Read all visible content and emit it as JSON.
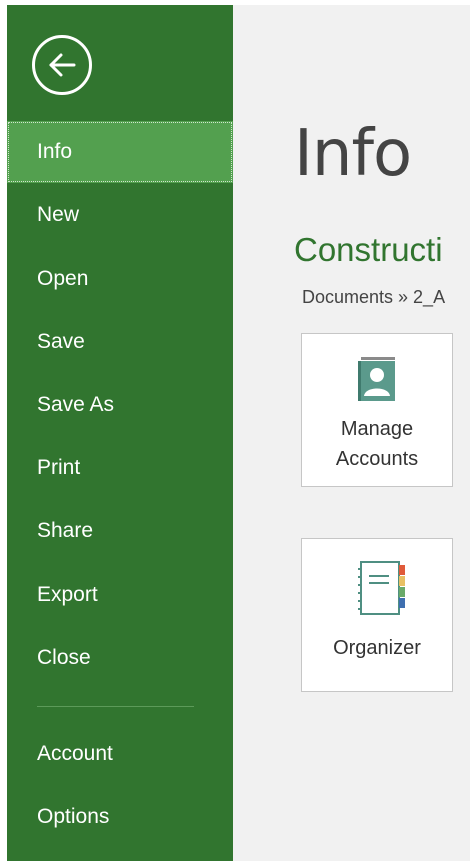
{
  "sidebar": {
    "back_button": "back-arrow-icon",
    "items": [
      {
        "label": "Info"
      },
      {
        "label": "New"
      },
      {
        "label": "Open"
      },
      {
        "label": "Save"
      },
      {
        "label": "Save As"
      },
      {
        "label": "Print"
      },
      {
        "label": "Share"
      },
      {
        "label": "Export"
      },
      {
        "label": "Close"
      },
      {
        "label": "Account"
      },
      {
        "label": "Options"
      }
    ],
    "active_item": "Info"
  },
  "main": {
    "title": "Info",
    "document_title": "Constructi",
    "document_path": "Documents » 2_A",
    "tiles": [
      {
        "label": "Manage\nAccounts",
        "icon": "manage-accounts-icon"
      },
      {
        "label": "Organizer",
        "icon": "organizer-icon"
      }
    ]
  },
  "colors": {
    "sidebar_bg": "#31752f",
    "sidebar_active": "#53a04f",
    "accent_green": "#31752f",
    "content_bg": "#f1f1f1"
  }
}
